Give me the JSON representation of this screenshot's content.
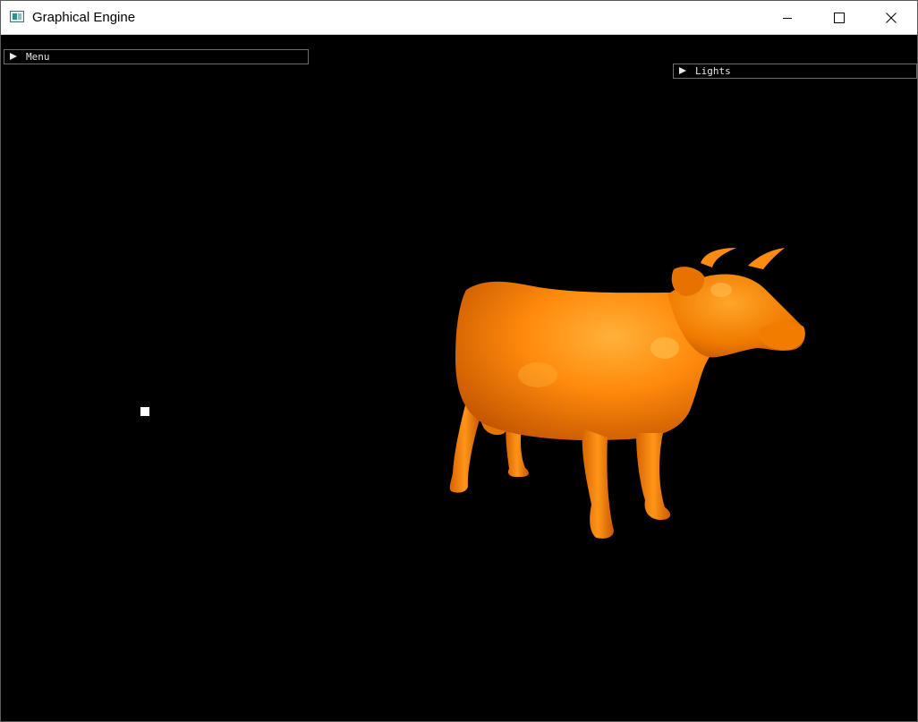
{
  "window": {
    "title": "Graphical Engine",
    "icons": {
      "app": "app-window-icon",
      "minimize": "minimize-icon",
      "maximize": "maximize-icon",
      "close": "close-icon"
    }
  },
  "panels": {
    "menu": {
      "label": "Menu",
      "state": "collapsed",
      "icon": "triangle-right-icon"
    },
    "lights": {
      "label": "Lights",
      "state": "collapsed",
      "icon": "triangle-right-icon"
    }
  },
  "scene": {
    "background_color": "#000000",
    "model": "cow",
    "model_color": "#ff8000",
    "light_marker_color": "#ffffff"
  }
}
